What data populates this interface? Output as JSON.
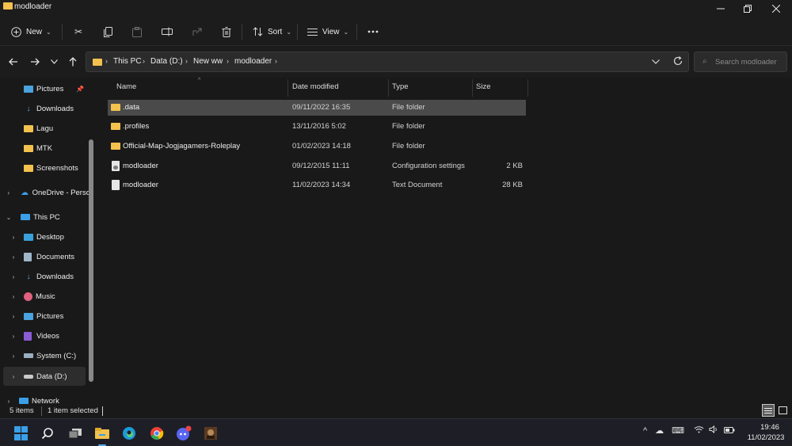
{
  "window": {
    "title": "modloader",
    "minimize_icon": "minimize-icon",
    "maximize_icon": "restore-icon",
    "close_icon": "close-icon"
  },
  "toolbar": {
    "new_label": "New",
    "sort_label": "Sort",
    "view_label": "View"
  },
  "address": {
    "breadcrumbs": [
      "This PC",
      "Data (D:)",
      "New ww",
      "modloader"
    ],
    "search_placeholder": "Search modloader"
  },
  "sidebar": {
    "items": [
      {
        "label": "Pictures",
        "icon": "pictures-icon",
        "pinned": true
      },
      {
        "label": "Downloads",
        "icon": "download-icon"
      },
      {
        "label": "Lagu",
        "icon": "folder-icon"
      },
      {
        "label": "MTK",
        "icon": "folder-icon"
      },
      {
        "label": "Screenshots",
        "icon": "folder-icon"
      },
      {
        "label": "OneDrive - Perso",
        "icon": "onedrive-icon"
      },
      {
        "label": "This PC",
        "icon": "pc-icon"
      },
      {
        "label": "Desktop",
        "icon": "desktop-icon"
      },
      {
        "label": "Documents",
        "icon": "documents-icon"
      },
      {
        "label": "Downloads",
        "icon": "download-icon"
      },
      {
        "label": "Music",
        "icon": "music-icon"
      },
      {
        "label": "Pictures",
        "icon": "pictures-icon"
      },
      {
        "label": "Videos",
        "icon": "videos-icon"
      },
      {
        "label": "System (C:)",
        "icon": "drive-icon"
      },
      {
        "label": "Data (D:)",
        "icon": "drive-icon",
        "selected": true
      },
      {
        "label": "Network",
        "icon": "network-icon"
      }
    ]
  },
  "columns": {
    "name": "Name",
    "date": "Date modified",
    "type": "Type",
    "size": "Size"
  },
  "files": [
    {
      "name": ".data",
      "date": "09/11/2022 16:35",
      "type": "File folder",
      "size": "",
      "icon": "folder-icon",
      "selected": true
    },
    {
      "name": ".profiles",
      "date": "13/11/2016 5:02",
      "type": "File folder",
      "size": "",
      "icon": "folder-icon"
    },
    {
      "name": "Official-Map-Jogjagamers-Roleplay",
      "date": "01/02/2023 14:18",
      "type": "File folder",
      "size": "",
      "icon": "folder-icon"
    },
    {
      "name": "modloader",
      "date": "09/12/2015 11:11",
      "type": "Configuration settings",
      "size": "2 KB",
      "icon": "config-file-icon"
    },
    {
      "name": "modloader",
      "date": "11/02/2023 14:34",
      "type": "Text Document",
      "size": "28 KB",
      "icon": "text-file-icon"
    }
  ],
  "status": {
    "item_count": "5 items",
    "selection": "1 item selected"
  },
  "clock": {
    "time": "19:46",
    "date": "11/02/2023"
  },
  "colors": {
    "accent": "#3b9fe8",
    "folder": "#f2c14e",
    "background": "#191919"
  }
}
